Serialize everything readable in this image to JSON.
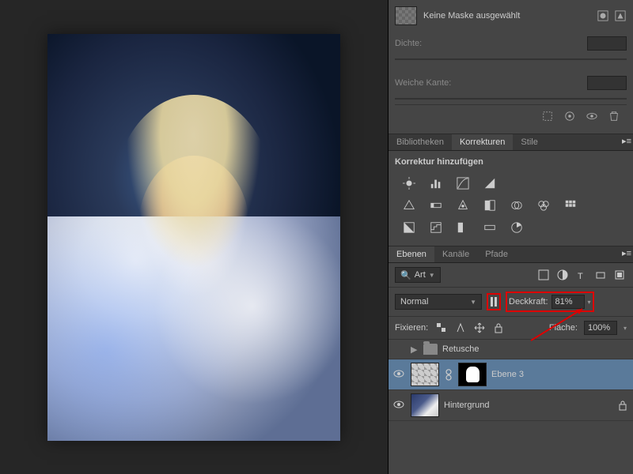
{
  "mask": {
    "label": "Keine Maske ausgewählt",
    "density_label": "Dichte:",
    "feather_label": "Weiche Kante:"
  },
  "tabs_adj": {
    "lib": "Bibliotheken",
    "adj": "Korrekturen",
    "styles": "Stile"
  },
  "adjustments": {
    "title": "Korrektur hinzufügen"
  },
  "tabs_lay": {
    "layers": "Ebenen",
    "channels": "Kanäle",
    "paths": "Pfade"
  },
  "layers": {
    "filter_label": "Art",
    "blend_mode": "Normal",
    "opacity_label": "Deckkraft:",
    "opacity_value": "81%",
    "lock_label": "Fixieren:",
    "fill_label": "Fläche:",
    "fill_value": "100%",
    "folder": "Retusche",
    "items": [
      {
        "name": "Ebene 3"
      },
      {
        "name": "Hintergrund"
      }
    ]
  },
  "icons": {
    "search": "🔍"
  }
}
